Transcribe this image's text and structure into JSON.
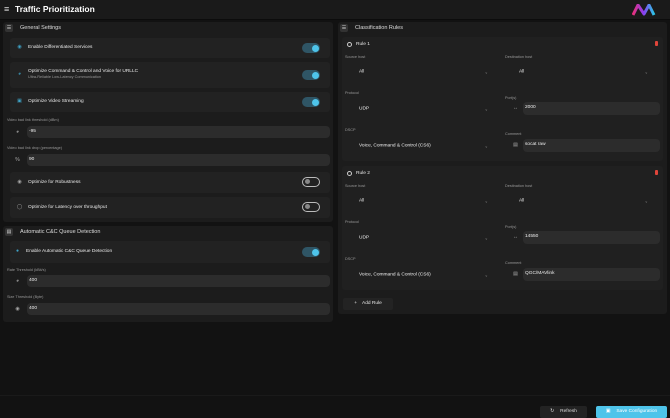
{
  "header": {
    "title": "Traffic Prioritization",
    "logo_text": "M"
  },
  "general": {
    "title": "General Settings",
    "toggles": [
      {
        "label": "Enable Differentiated Services",
        "on": true
      },
      {
        "label": "Optimize Command & Control and Voice for URLLC",
        "sub": "Ultra-Reliable Low-Latency Communication",
        "on": true
      },
      {
        "label": "Optimize Video Streaming",
        "on": true
      },
      {
        "label": "Optimize for Robustness",
        "on": false
      },
      {
        "label": "Optimize for Latency over throughput",
        "on": false
      }
    ],
    "threshold_label": "Video bad link threshold (dBm)",
    "threshold_value": "-95",
    "drop_label": "Video bad link drop (percentage)",
    "drop_value": "90",
    "drop_icon": "%"
  },
  "cc": {
    "title": "Automatic C&C Queue Detection",
    "toggle_label": "Enable Automatic C&C Queue Detection",
    "toggle_on": true,
    "rate_label": "Rate Threshold (kBit/s)",
    "rate_value": "400",
    "size_label": "Size Threshold (Byte)",
    "size_value": "400"
  },
  "rules": {
    "title": "Classification Rules",
    "labels": {
      "source": "Source host",
      "dest": "Destination host",
      "protocol": "Protocol",
      "ports": "Port(s)",
      "dscp": "DSCP",
      "comment": "Comment"
    },
    "items": [
      {
        "name": "Rule 1",
        "source": "All",
        "dest": "All",
        "protocol": "UDP",
        "ports": "2000",
        "dscp": "Voice, Command & Control (CS6)",
        "comment": "socat raw"
      },
      {
        "name": "Rule 2",
        "source": "All",
        "dest": "All",
        "protocol": "UDP",
        "ports": "14550",
        "dscp": "Voice, Command & Control (CS6)",
        "comment": "QGC/MAVlink"
      }
    ],
    "add_label": "Add Rule"
  },
  "footer": {
    "refresh": "Refresh",
    "save": "Save Configuration"
  },
  "colors": {
    "accent": "#4ec4ea",
    "delete": "#e0453a"
  }
}
